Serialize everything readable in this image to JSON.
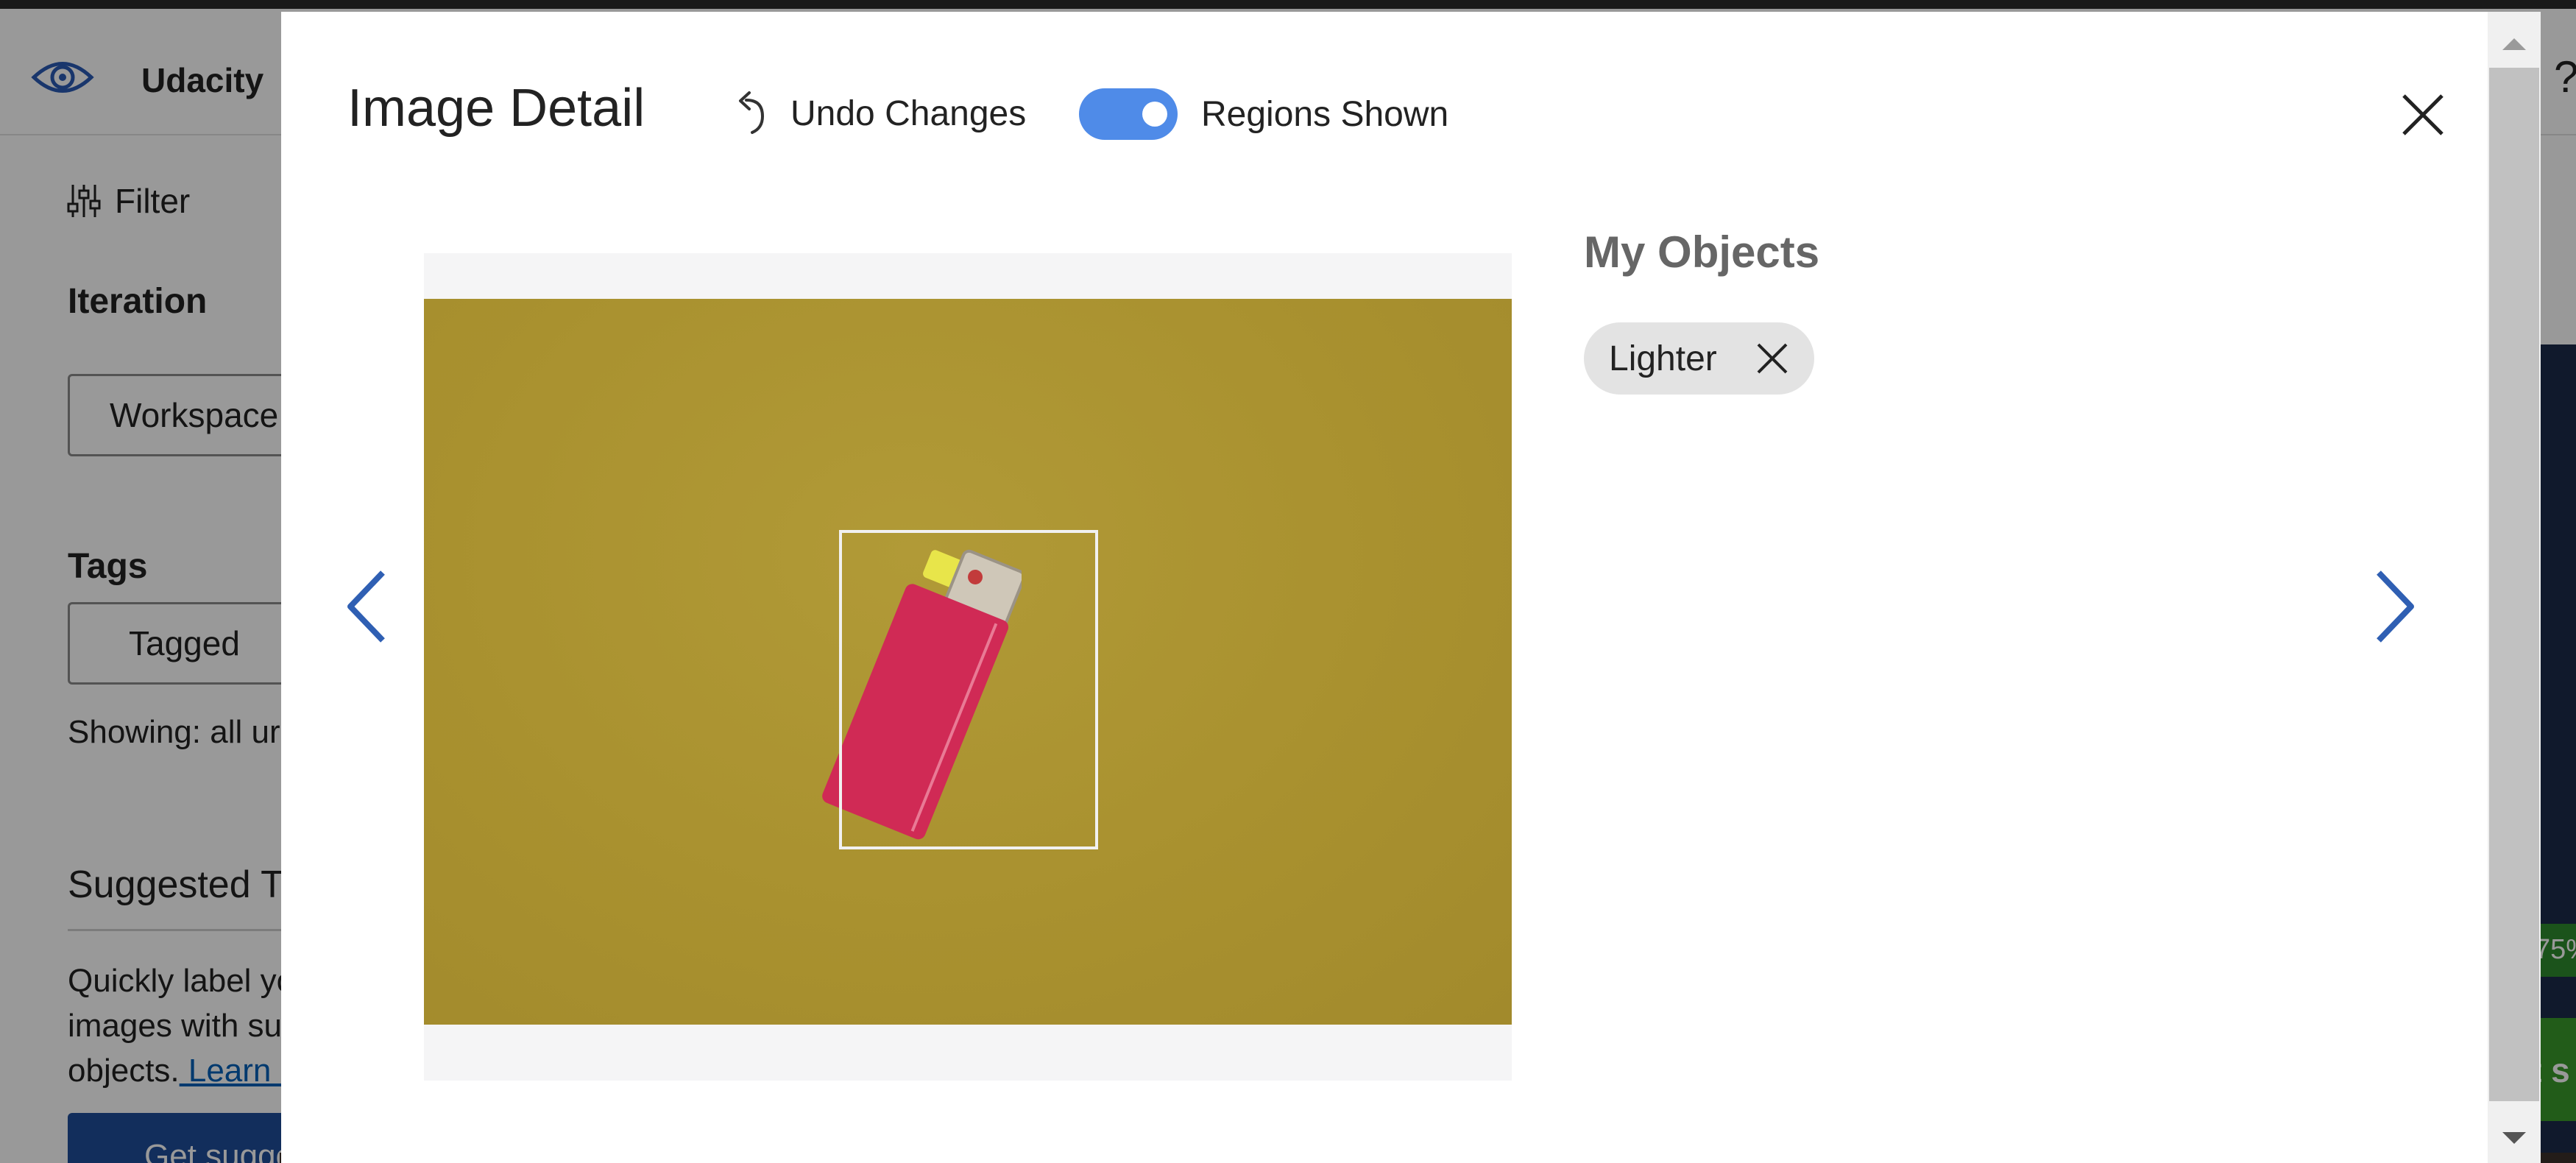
{
  "app": {
    "name": "Udacity",
    "help_glyph": "?",
    "sidebar": {
      "filter_label": "Filter",
      "iteration_heading": "Iteration",
      "iteration_value": "Workspace",
      "tags_heading": "Tags",
      "tags_value": "Tagged",
      "showing_text": "Showing: all ur",
      "suggested_heading": "Suggested T",
      "suggested_line1": "Quickly label yo",
      "suggested_line2": "images with sug",
      "suggested_line3": "objects.",
      "learn_more_link": " Learn m",
      "suggest_button": "Get suggested objects"
    },
    "right_panel": {
      "percent_badge": "75%",
      "action_fragment": "t s"
    }
  },
  "modal": {
    "title": "Image Detail",
    "undo_label": "Undo Changes",
    "regions_label": "Regions Shown",
    "regions_shown": true,
    "objects_heading": "My Objects",
    "tags": [
      {
        "label": "Lighter"
      }
    ]
  },
  "colors": {
    "toggle_on": "#4f8be8",
    "nav_arrow": "#2f5fb3",
    "photo_background": "#a9912f",
    "lighter_body": "#d02a55",
    "tag_chip": "#e3e3e3"
  },
  "icons": {
    "app_logo": "eye-gear-icon",
    "filter": "sliders-icon",
    "undo": "undo-arrow-icon",
    "close": "close-x-icon",
    "prev": "chevron-left-icon",
    "next": "chevron-right-icon",
    "tag_remove": "close-x-icon"
  }
}
